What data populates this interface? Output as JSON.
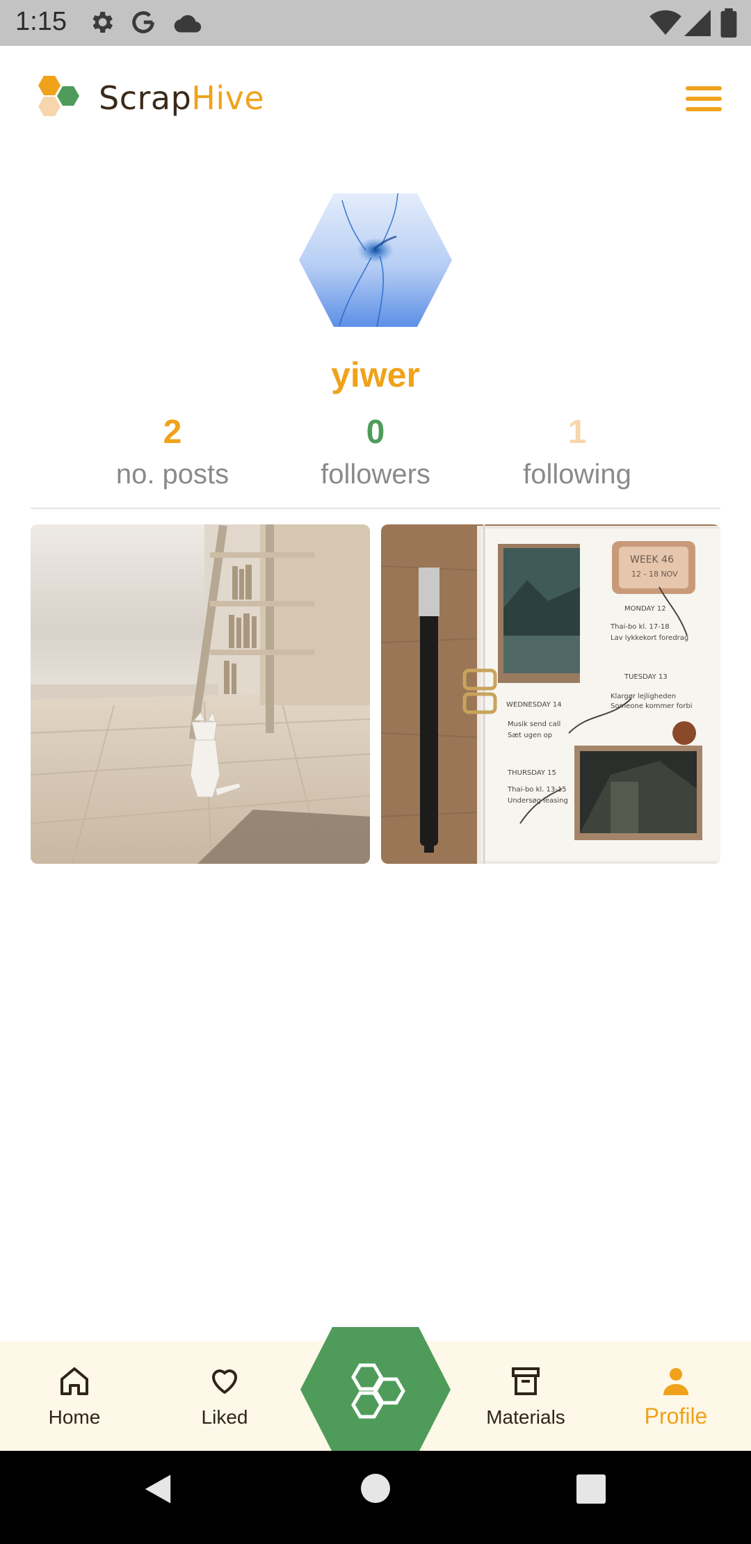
{
  "status_bar": {
    "time": "1:15",
    "icons_left": [
      "settings-icon",
      "google-icon",
      "cloud-icon"
    ],
    "icons_right": [
      "wifi-icon",
      "signal-icon",
      "battery-icon"
    ]
  },
  "header": {
    "brand_part1": "Scrap",
    "brand_part2": "Hive",
    "menu_icon": "hamburger-menu-icon"
  },
  "profile": {
    "username": "yiwer",
    "stats": {
      "posts": {
        "value": "2",
        "label": "no. posts"
      },
      "followers": {
        "value": "0",
        "label": "followers"
      },
      "following": {
        "value": "1",
        "label": "following"
      }
    }
  },
  "posts": [
    {
      "image": "room-with-paper-cat-image"
    },
    {
      "image": "bullet-journal-spread-image"
    }
  ],
  "bottom_nav": {
    "home": "Home",
    "liked": "Liked",
    "center_icon": "hive-create-icon",
    "materials": "Materials",
    "profile": "Profile",
    "active": "Profile"
  },
  "colors": {
    "accent_orange": "#f0a21b",
    "accent_green": "#4f9c5a",
    "light_peach": "#f7d6ac",
    "nav_background": "#fef8e8"
  }
}
